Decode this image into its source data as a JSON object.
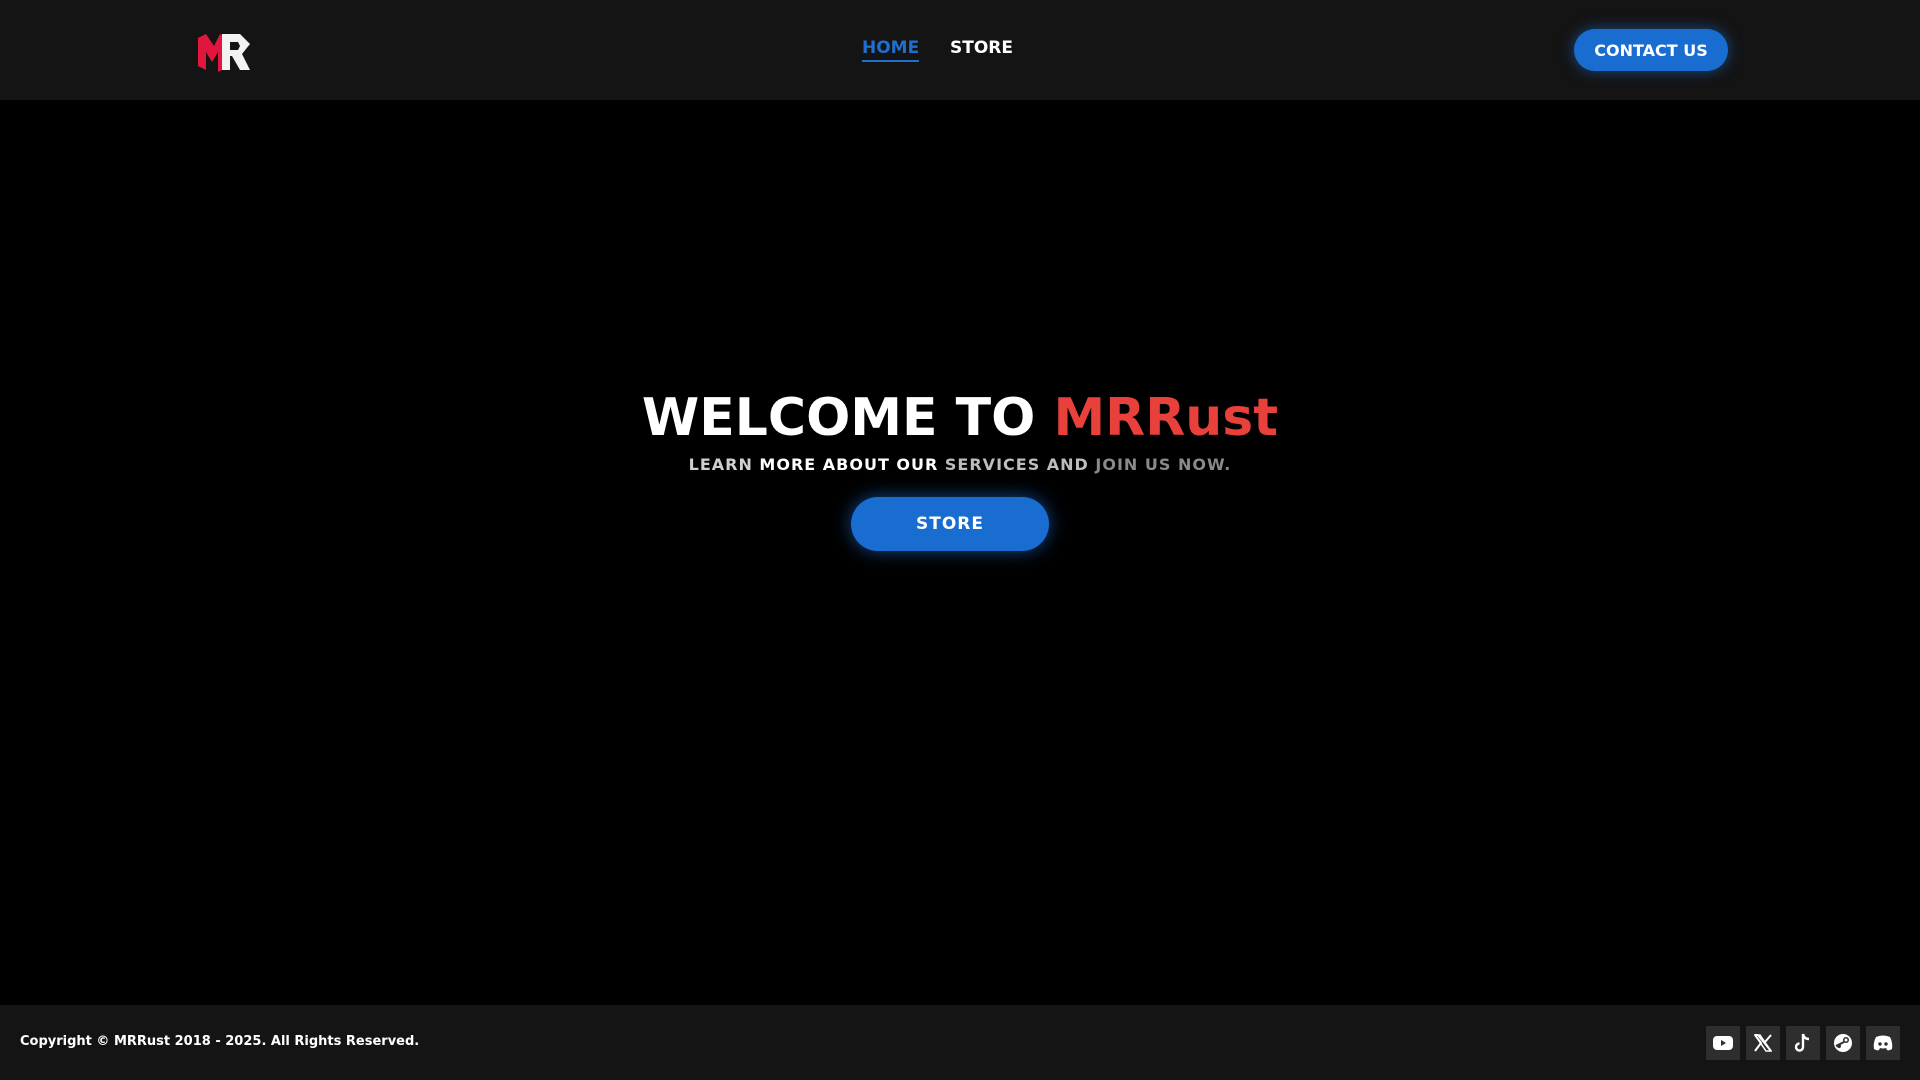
{
  "header": {
    "logo_alt": "MR logo",
    "nav": [
      {
        "label": "HOME",
        "active": true
      },
      {
        "label": "STORE",
        "active": false
      }
    ],
    "contact_label": "CONTACT US"
  },
  "hero": {
    "title_prefix": "WELCOME TO",
    "title_brand": "MRRust",
    "subtitle_parts": [
      "LEARN ",
      "MORE ABOUT OUR ",
      "SERVICES AND ",
      "JOIN US NOW."
    ],
    "cta_label": "STORE"
  },
  "footer": {
    "copyright": "Copyright © MRRust 2018 - 2025. All Rights Reserved.",
    "socials": [
      "youtube-icon",
      "x-icon",
      "tiktok-icon",
      "steam-icon",
      "discord-icon"
    ]
  },
  "colors": {
    "accent_blue": "#1a6dd0",
    "brand_red": "#e8413c",
    "header_bg": "#141414",
    "page_bg": "#000000"
  }
}
